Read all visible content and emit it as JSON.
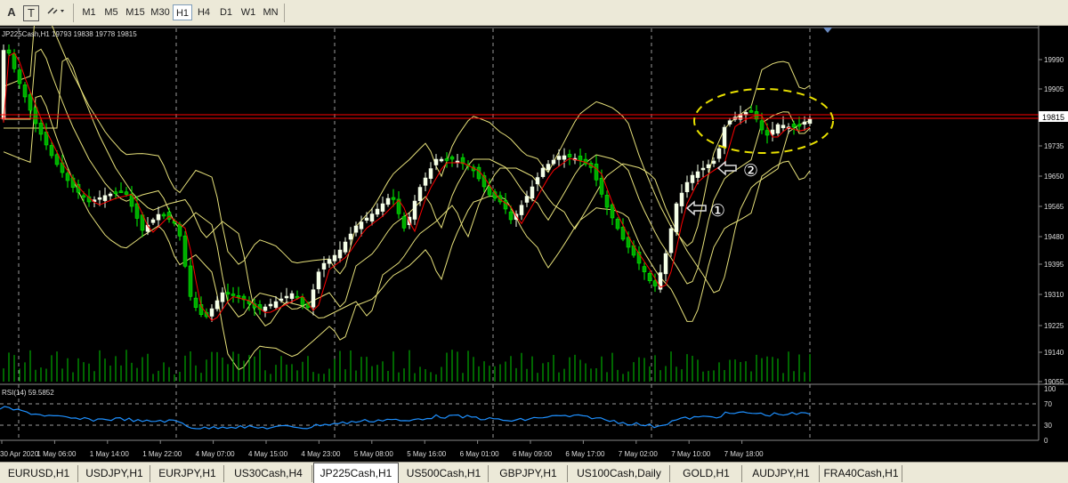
{
  "toolbar": {
    "text_tool": "A",
    "text_label_tool": "T",
    "timeframes": [
      "M1",
      "M5",
      "M15",
      "M30",
      "H1",
      "H4",
      "D1",
      "W1",
      "MN"
    ],
    "selected_timeframe": "H1"
  },
  "chart": {
    "header": "JP225Cash,H1  19793 19838 19778 19815",
    "price_axis": [
      "19990",
      "19905",
      "19815",
      "19735",
      "19650",
      "19565",
      "19480",
      "19395",
      "19310",
      "19225",
      "19140",
      "19055"
    ],
    "current_price": "19815",
    "time_axis": [
      "30 Apr 2020",
      "1 May 06:00",
      "1 May 14:00",
      "1 May 22:00",
      "4 May 07:00",
      "4 May 15:00",
      "4 May 23:00",
      "5 May 08:00",
      "5 May 16:00",
      "6 May 01:00",
      "6 May 09:00",
      "6 May 17:00",
      "7 May 02:00",
      "7 May 10:00",
      "7 May 18:00"
    ],
    "annotation_1": "①",
    "annotation_2": "②",
    "colors": {
      "bull": "#f5ffe8",
      "bear": "#00ff00",
      "ma": "#ff0000",
      "bands": "#e6e07a",
      "rsi": "#1e90ff",
      "price_line": "#ff0000",
      "highlight": "#e8e000"
    }
  },
  "rsi": {
    "label": "RSI(14) 59.5852",
    "axis": [
      "100",
      "70",
      "30",
      "0"
    ]
  },
  "symbol_tabs": [
    "EURUSD,H1",
    "USDJPY,H1",
    "EURJPY,H1",
    "US30Cash,H4",
    "JP225Cash,H1",
    "US500Cash,H1",
    "GBPJPY,H1",
    "US100Cash,Daily",
    "GOLD,H1",
    "AUDJPY,H1",
    "FRA40Cash,H1"
  ],
  "active_tab": "JP225Cash,H1"
}
